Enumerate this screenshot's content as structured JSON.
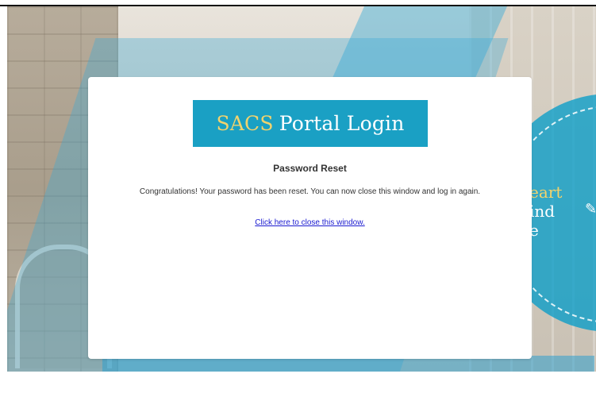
{
  "logo": {
    "brand": "SACS",
    "product": "Portal Login"
  },
  "page": {
    "title": "Password Reset",
    "message": "Congratulations! Your password has been reset. You can now close this window and log in again.",
    "close_link": "Click here to close this window."
  },
  "background": {
    "circle_lines": [
      "eart",
      "ind",
      "e"
    ]
  },
  "colors": {
    "brand_blue": "#1aa0c4",
    "brand_gold": "#f2d36d",
    "link": "#1a1ad0"
  }
}
